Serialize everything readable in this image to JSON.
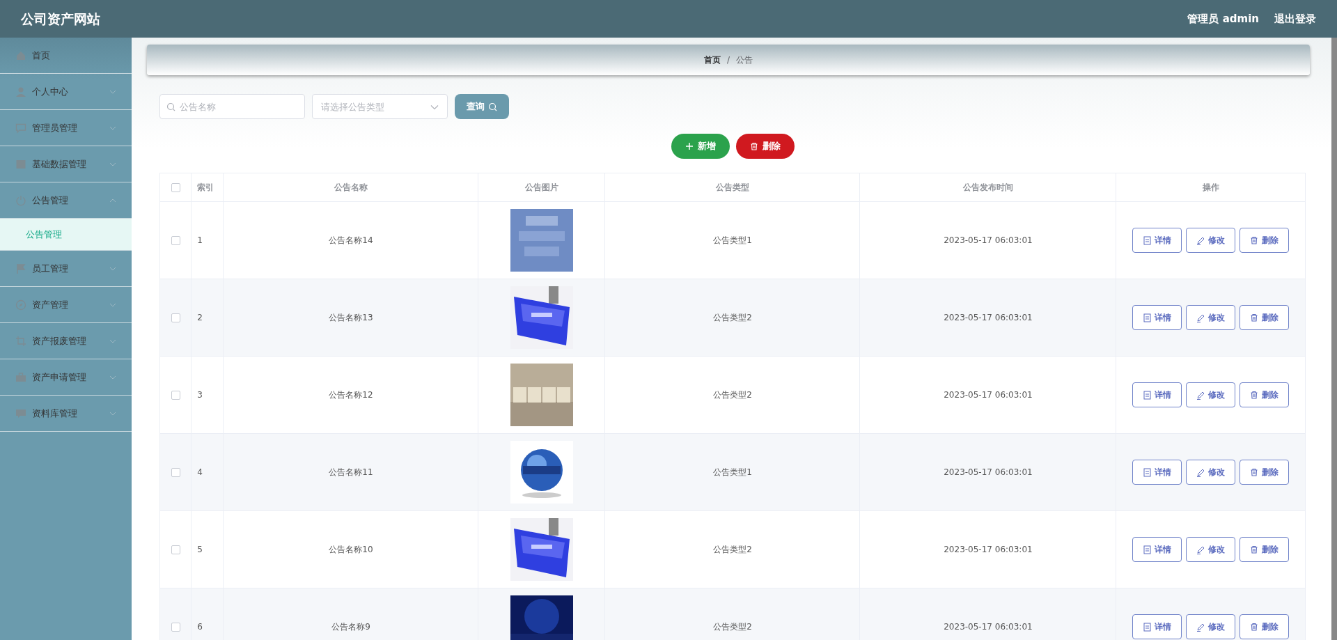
{
  "header": {
    "title": "公司资产网站",
    "user": "管理员 admin",
    "logout": "退出登录"
  },
  "sidebar": {
    "items": [
      {
        "label": "首页"
      },
      {
        "label": "个人中心",
        "expanded": false
      },
      {
        "label": "管理员管理",
        "expanded": false
      },
      {
        "label": "基础数据管理",
        "expanded": false
      },
      {
        "label": "公告管理",
        "expanded": true,
        "children": [
          {
            "label": "公告管理",
            "selected": true
          }
        ]
      },
      {
        "label": "员工管理",
        "expanded": false
      },
      {
        "label": "资产管理",
        "expanded": false
      },
      {
        "label": "资产报废管理",
        "expanded": false
      },
      {
        "label": "资产申请管理",
        "expanded": false
      },
      {
        "label": "资料库管理",
        "expanded": false
      }
    ]
  },
  "breadcrumb": {
    "items": [
      "首页",
      "公告"
    ],
    "separator": "/"
  },
  "search": {
    "name_placeholder": "公告名称",
    "type_placeholder": "请选择公告类型",
    "query_button": "查询"
  },
  "actions": {
    "add": "新增",
    "delete": "删除"
  },
  "table": {
    "select_all": {
      "checked": false
    },
    "columns": [
      "索引",
      "公告名称",
      "公告图片",
      "公告类型",
      "公告发布时间",
      "操作"
    ],
    "rows": [
      {
        "checked": false,
        "index": "1",
        "name": "公告名称14",
        "type": "公告类型1",
        "time": "2023-05-17 06:03:01",
        "buttons": [
          "详情",
          "修改",
          "删除"
        ]
      },
      {
        "checked": false,
        "index": "2",
        "name": "公告名称13",
        "type": "公告类型2",
        "time": "2023-05-17 06:03:01",
        "buttons": [
          "详情",
          "修改",
          "删除"
        ]
      },
      {
        "checked": false,
        "index": "3",
        "name": "公告名称12",
        "type": "公告类型2",
        "time": "2023-05-17 06:03:01",
        "buttons": [
          "详情",
          "修改",
          "删除"
        ]
      },
      {
        "checked": false,
        "index": "4",
        "name": "公告名称11",
        "type": "公告类型1",
        "time": "2023-05-17 06:03:01",
        "buttons": [
          "详情",
          "修改",
          "删除"
        ]
      },
      {
        "checked": false,
        "index": "5",
        "name": "公告名称10",
        "type": "公告类型2",
        "time": "2023-05-17 06:03:01",
        "buttons": [
          "详情",
          "修改",
          "删除"
        ]
      },
      {
        "checked": false,
        "index": "6",
        "name": "公告名称9",
        "type": "公告类型2",
        "time": "2023-05-17 06:03:01",
        "buttons": [
          "详情",
          "修改",
          "删除"
        ]
      }
    ]
  }
}
